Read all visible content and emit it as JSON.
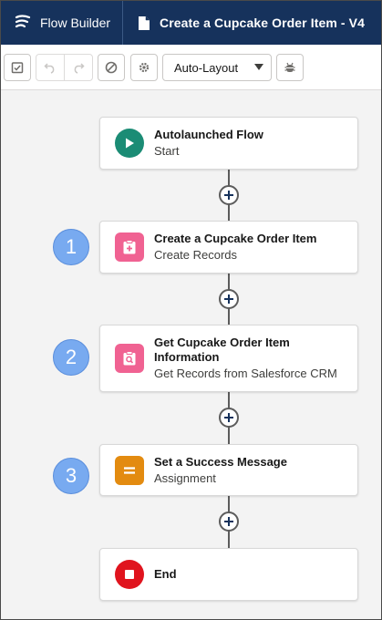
{
  "header": {
    "app_name": "Flow Builder",
    "flow_title": "Create a Cupcake Order Item - V4"
  },
  "toolbar": {
    "layout_select": {
      "value": "Auto-Layout"
    }
  },
  "flow": {
    "nodes": [
      {
        "title": "Autolaunched Flow",
        "subtitle": "Start"
      },
      {
        "title": "Create a Cupcake Order Item",
        "subtitle": "Create Records",
        "step": "1"
      },
      {
        "title": "Get Cupcake Order Item",
        "title_line2": "Information",
        "subtitle": "Get Records from Salesforce CRM",
        "step": "2"
      },
      {
        "title": "Set a Success Message",
        "subtitle": "Assignment",
        "step": "3"
      },
      {
        "title": "End"
      }
    ]
  },
  "colors": {
    "header_bg": "#16325c",
    "start_icon": "#1b8c75",
    "records_icon": "#f06292",
    "assignment_icon": "#e38b10",
    "end_icon": "#e0141e",
    "step_badge": "#78aaf0"
  }
}
